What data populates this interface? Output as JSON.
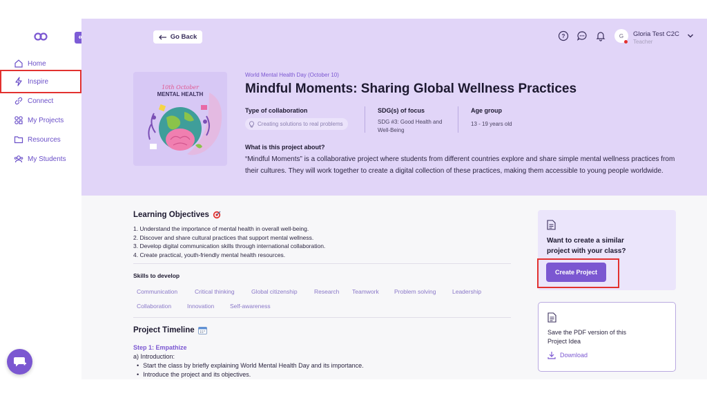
{
  "sidebar": {
    "items": [
      {
        "label": "Home",
        "icon": "home-icon"
      },
      {
        "label": "Inspire",
        "icon": "lightning-icon",
        "active": true
      },
      {
        "label": "Connect",
        "icon": "link-icon"
      },
      {
        "label": "My Projects",
        "icon": "projects-icon"
      },
      {
        "label": "Resources",
        "icon": "folder-icon"
      },
      {
        "label": "My Students",
        "icon": "students-icon"
      }
    ]
  },
  "header": {
    "back_label": "Go Back",
    "user": {
      "initial": "G",
      "name": "Gloria Test C2C",
      "role": "Teacher"
    }
  },
  "project": {
    "cover": {
      "line1": "10th October",
      "line2": "MENTAL HEALTH"
    },
    "event": "World Mental Health Day (October 10)",
    "title": "Mindful Moments: Sharing Global Wellness Practices",
    "collab_heading": "Type of collaboration",
    "collab_value": "Creating solutions to real problems",
    "sdg_heading": "SDG(s) of focus",
    "sdg_value_1": "SDG #3: Good Health and",
    "sdg_value_2": "Well-Being",
    "age_heading": "Age group",
    "age_value": "13 - 19 years old",
    "about_heading": "What is this project about?",
    "about_text": "“Mindful Moments” is a collaborative project where students from different countries explore and share simple mental wellness practices from their cultures. They will work together to create a digital collection of these practices, making them accessible to young people worldwide."
  },
  "objectives": {
    "heading": "Learning Objectives",
    "items": [
      "1. Understand the importance of mental health in overall well-being.",
      "2. Discover and share cultural practices that support mental wellness.",
      "3. Develop digital communication skills through international collaboration.",
      "4. Create practical, youth-friendly mental health resources."
    ]
  },
  "skills": {
    "heading": "Skills to develop",
    "items": [
      "Communication",
      "Critical thinking",
      "Global citizenship",
      "Research",
      "Teamwork",
      "Problem solving",
      "Leadership",
      "Collaboration",
      "Innovation",
      "Self-awareness"
    ]
  },
  "timeline": {
    "heading": "Project Timeline",
    "step": "Step 1: Empathize",
    "sub": "a) Introduction:",
    "bullets": [
      "Start the class by briefly explaining World Mental Health Day and its importance.",
      "Introduce the project and its objectives."
    ]
  },
  "cta": {
    "text": "Want to create a similar project with your class?",
    "button": "Create Project"
  },
  "pdf": {
    "text": "Save the PDF version of this Project Idea",
    "download": "Download"
  },
  "colors": {
    "accent": "#7b57d1",
    "hero_bg": "#e1d5f8",
    "highlight": "#e2312f"
  }
}
